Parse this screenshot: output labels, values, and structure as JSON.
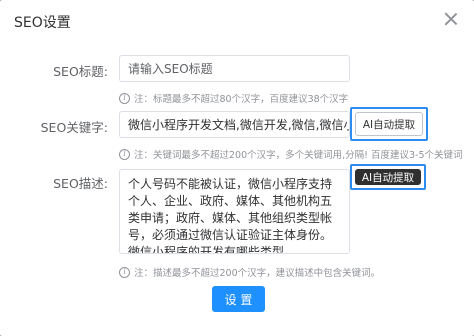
{
  "dialog": {
    "title": "SEO设置"
  },
  "seo_title": {
    "label": "SEO标题:",
    "placeholder": "请输入SEO标题",
    "hint": "注：标题最多不超过80个汉字，百度建议38个汉字"
  },
  "seo_keywords": {
    "label": "SEO关键字:",
    "value": "微信小程序开发文档,微信开发,微信,微信小程序",
    "ai_button": "AI自动提取",
    "hint": "注：关键词最多不超过200个汉字，多个关键词用,分隔! 百度建议3-5个关键词"
  },
  "seo_description": {
    "label": "SEO描述:",
    "value": "个人号码不能被认证，微信小程序支持个人、企业、政府、媒体、其他机构五类申请；政府、媒体、其他组织类型帐号，必须通过微信认证验证主体身份。微信小程序的开发有哪些类型。",
    "ai_button": "AI自动提取",
    "hint": "注：描述最多不超过200个汉字，建议描述中包含关键词。"
  },
  "submit_button": "设 置",
  "icons": {
    "close": "close-icon",
    "info": "info-icon"
  },
  "colors": {
    "primary": "#1e90ff",
    "highlight_frame": "#2d8cf0",
    "dark_button": "#2f2f2f"
  }
}
